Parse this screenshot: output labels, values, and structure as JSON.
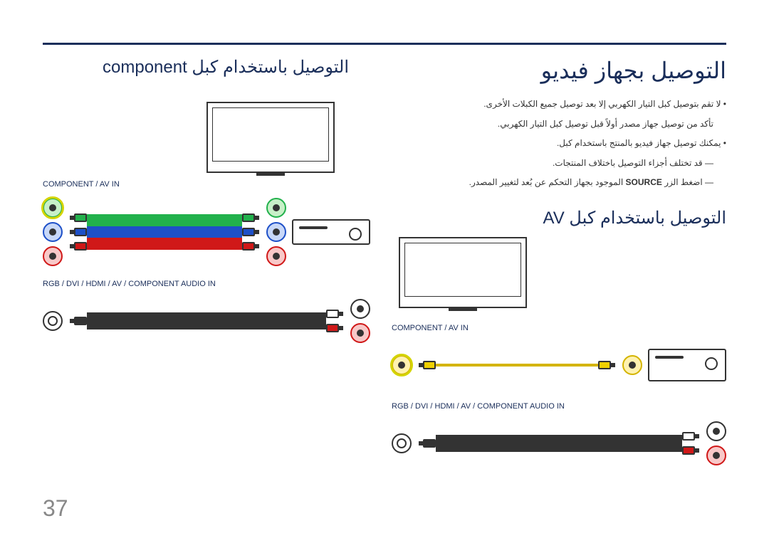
{
  "page_number": "37",
  "right_column": {
    "main_title": "التوصيل بجهاز فيديو",
    "bullet1": "لا تقم بتوصيل كبل التيار الكهربي إلا بعد توصيل جميع الكبلات الأخرى.",
    "bullet1b": "تأكد من توصيل جهاز مصدر أولاً قبل توصيل كبل التيار الكهربي.",
    "bullet2": "يمكنك توصيل جهاز فيديو بالمنتج باستخدام كبل.",
    "dash1": "قد تختلف أجزاء التوصيل باختلاف المنتجات.",
    "dash2_pre": "اضغط الزر ",
    "dash2_src": "SOURCE",
    "dash2_post": " الموجود بجهاز التحكم عن بُعد لتغيير المصدر.",
    "sub_title_av": "التوصيل باستخدام كبل AV",
    "label_component_avin": "COMPONENT / AV IN",
    "label_audio_in": "RGB / DVI / HDMI / AV / COMPONENT AUDIO IN"
  },
  "left_column": {
    "sub_title_component": "التوصيل باستخدام كبل component",
    "label_component_avin": "COMPONENT / AV IN",
    "label_audio_in": "RGB / DVI / HDMI / AV / COMPONENT AUDIO IN"
  }
}
